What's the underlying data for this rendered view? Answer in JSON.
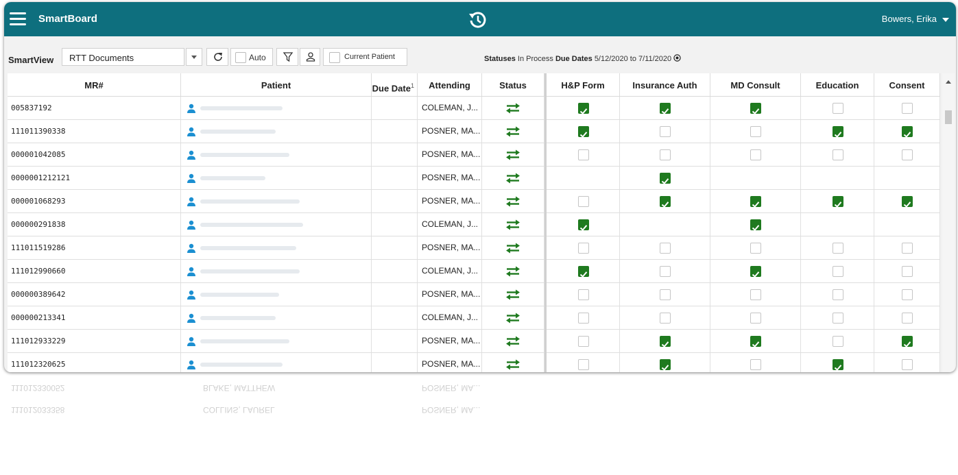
{
  "app": {
    "title": "SmartBoard",
    "user": "Bowers, Erika"
  },
  "toolbar": {
    "smartview_label": "SmartView",
    "smartview_value": "RTT Documents",
    "auto_label": "Auto",
    "current_patient_label": "Current Patient",
    "statuses_label": "Statuses",
    "statuses_value": "In Process",
    "due_dates_label": "Due Dates",
    "due_dates_value": "5/12/2020 to 7/11/2020"
  },
  "table": {
    "headers": {
      "mr": "MR#",
      "patient": "Patient",
      "due_date": "Due Date",
      "due_date_sup": "1",
      "attending": "Attending",
      "status": "Status",
      "hp_form": "H&P Form",
      "insurance_auth": "Insurance Auth",
      "md_consult": "MD Consult",
      "education": "Education",
      "consent": "Consent"
    },
    "rows": [
      {
        "mr": "005837192",
        "attending": "COLEMAN, J...",
        "docs": [
          "on",
          "on",
          "on",
          "off",
          "off"
        ]
      },
      {
        "mr": "111011390338",
        "attending": "POSNER, MA...",
        "docs": [
          "on",
          "off",
          "off",
          "on",
          "on"
        ]
      },
      {
        "mr": "000001042085",
        "attending": "POSNER, MA...",
        "docs": [
          "off",
          "off",
          "off",
          "off",
          "off"
        ]
      },
      {
        "mr": "0000001212121",
        "attending": "POSNER, MA...",
        "docs": [
          "none",
          "on",
          "none",
          "none",
          "none"
        ]
      },
      {
        "mr": "000001068293",
        "attending": "POSNER, MA...",
        "docs": [
          "off",
          "on",
          "on",
          "on",
          "on"
        ]
      },
      {
        "mr": "000000291838",
        "attending": "COLEMAN, J...",
        "docs": [
          "on",
          "none",
          "on",
          "none",
          "none"
        ]
      },
      {
        "mr": "111011519286",
        "attending": "POSNER, MA...",
        "docs": [
          "off",
          "off",
          "off",
          "off",
          "off"
        ]
      },
      {
        "mr": "111012990660",
        "attending": "COLEMAN, J...",
        "docs": [
          "on",
          "off",
          "on",
          "off",
          "off"
        ]
      },
      {
        "mr": "000000389642",
        "attending": "POSNER, MA...",
        "docs": [
          "off",
          "off",
          "off",
          "off",
          "off"
        ]
      },
      {
        "mr": "000000213341",
        "attending": "COLEMAN, J...",
        "docs": [
          "off",
          "off",
          "off",
          "off",
          "off"
        ]
      },
      {
        "mr": "111012933229",
        "attending": "POSNER, MA...",
        "docs": [
          "off",
          "on",
          "on",
          "off",
          "on"
        ]
      },
      {
        "mr": "111012320625",
        "attending": "POSNER, MA...",
        "docs": [
          "off",
          "on",
          "off",
          "on",
          "off"
        ]
      }
    ]
  },
  "reflection": [
    {
      "mr": "111012330052",
      "patient": "BLAKE, MATTHEW",
      "attending": "POSNER, MA..."
    },
    {
      "mr": "111012033358",
      "patient": "COLLINS, LAUREL",
      "attending": "POSNER, MA..."
    }
  ],
  "colors": {
    "titlebar": "#0e6f7e",
    "check": "#1f7a1f",
    "status_icon": "#1f7a1f",
    "person_icon": "#1b8fd1"
  },
  "icons": {
    "menu": "hamburger-icon",
    "history": "history-icon",
    "refresh": "refresh-icon",
    "filter": "filter-icon",
    "person": "person-icon",
    "status": "transfer-arrows-icon"
  }
}
